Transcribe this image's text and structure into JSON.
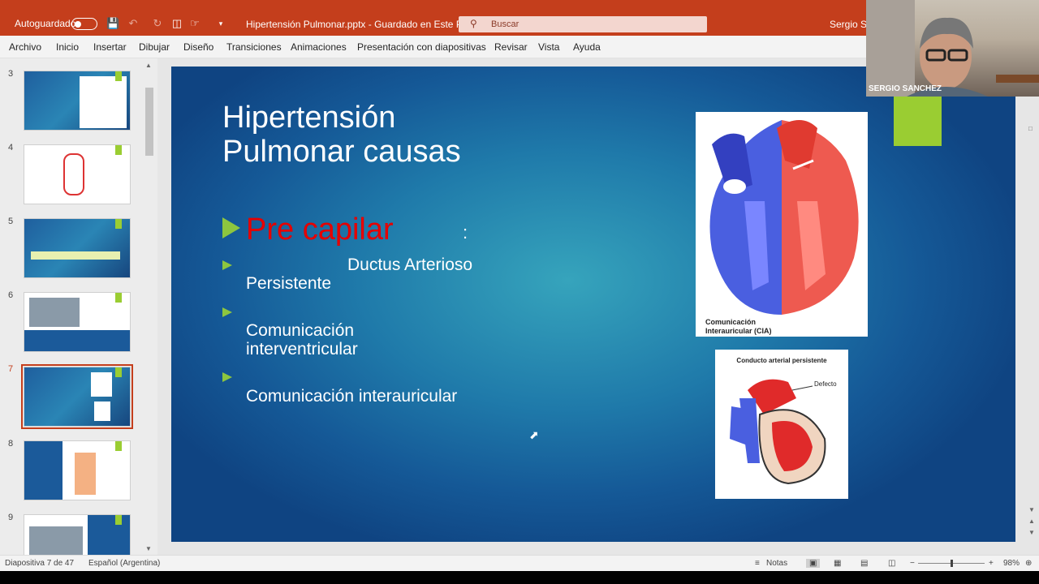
{
  "titlebar": {
    "autosave_label": "Autoguardado",
    "doc_title": "Hipertensión Pulmonar.pptx - Guardado en Este PC",
    "search_placeholder": "Buscar",
    "user": "Sergio Sar",
    "icons": [
      "save-icon",
      "undo-icon",
      "redo-icon",
      "present-icon",
      "touch-icon",
      "customize-icon"
    ]
  },
  "ribbon": {
    "tabs": [
      "Archivo",
      "Inicio",
      "Insertar",
      "Dibujar",
      "Diseño",
      "Transiciones",
      "Animaciones",
      "Presentación con diapositivas",
      "Revisar",
      "Vista",
      "Ayuda"
    ]
  },
  "thumbnails": [
    {
      "num": "3",
      "active": false
    },
    {
      "num": "4",
      "active": false
    },
    {
      "num": "5",
      "active": false
    },
    {
      "num": "6",
      "active": false
    },
    {
      "num": "7",
      "active": true
    },
    {
      "num": "8",
      "active": false
    },
    {
      "num": "9",
      "active": false
    }
  ],
  "slide": {
    "title_line1": "Hipertensión",
    "title_line2": "Pulmonar causas",
    "main_bullet": "Pre capilar",
    "main_bullet_suffix": ":",
    "b1_line1": "Ductus Arterioso",
    "b1_line2": "Persistente",
    "b2_line1": "Comunicación",
    "b2_line2": "interventricular",
    "b3_line1": "Comunicación interauricular",
    "img1_caption_1": "Comunicación",
    "img1_caption_2": "Interauricular (CIA)",
    "img2_caption": "Conducto arterial persistente",
    "img2_label": "Defecto"
  },
  "webcam": {
    "name": "SERGIO SANCHEZ"
  },
  "status": {
    "slide_info": "Diapositiva 7 de 47",
    "language": "Español (Argentina)",
    "notes": "Notas",
    "zoom": "98%"
  },
  "colors": {
    "accent": "#c43e1c",
    "green": "#8dc63f",
    "red_text": "#e60000"
  }
}
